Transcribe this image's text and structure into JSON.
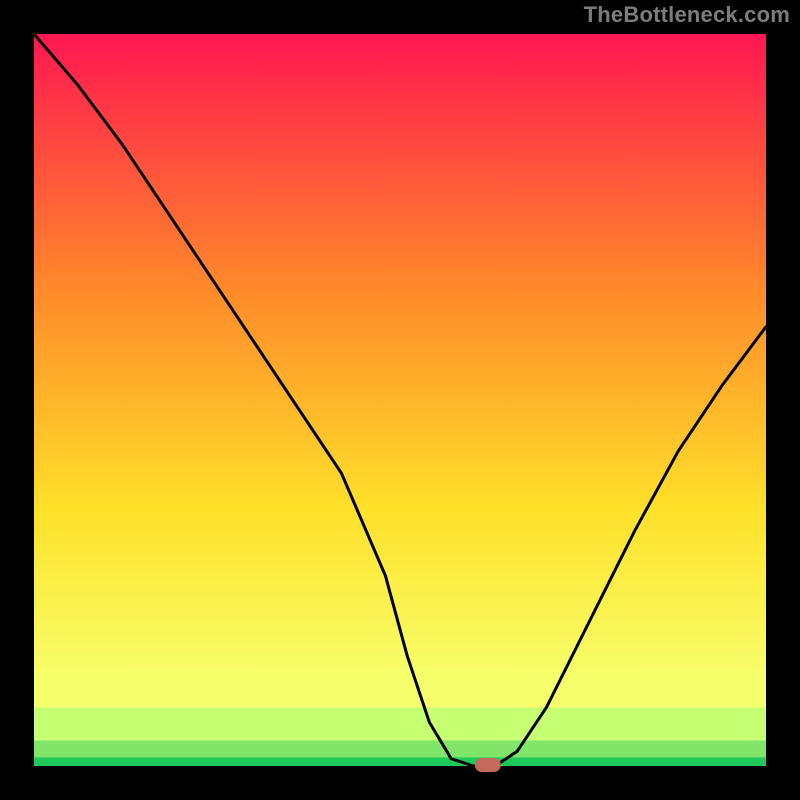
{
  "watermark": "TheBottleneck.com",
  "colors": {
    "frame": "#000000",
    "curve": "#000000",
    "marker_fill": "#c46a5d",
    "highlight_band": "#c7ff72",
    "green_band": "#1fca5a",
    "gradient_top": "#ff1751",
    "gradient_mid1": "#ff8a2a",
    "gradient_mid2": "#ffe12a",
    "gradient_low": "#f6ff6b"
  },
  "geometry": {
    "outer": 800,
    "frame": 34,
    "inner": 732
  },
  "chart_data": {
    "type": "line",
    "title": "",
    "xlabel": "",
    "ylabel": "",
    "xlim": [
      0,
      100
    ],
    "ylim": [
      0,
      100
    ],
    "x": [
      0,
      6,
      12,
      18,
      24,
      30,
      36,
      42,
      48,
      51,
      54,
      57,
      60,
      63,
      66,
      70,
      76,
      82,
      88,
      94,
      100
    ],
    "values": [
      100,
      93,
      85,
      76,
      67,
      58,
      49,
      40,
      26,
      15,
      6,
      1,
      0,
      0,
      2,
      8,
      20,
      32,
      43,
      52,
      60
    ],
    "minimum_marker": {
      "x": 62,
      "y": 0
    },
    "background_bands": [
      {
        "from_y": 0.0,
        "to_y": 1.2,
        "color": "#1fca5a"
      },
      {
        "from_y": 1.2,
        "to_y": 3.5,
        "color": "#7fe66a"
      },
      {
        "from_y": 3.5,
        "to_y": 8.0,
        "color": "#c7ff72"
      }
    ]
  }
}
